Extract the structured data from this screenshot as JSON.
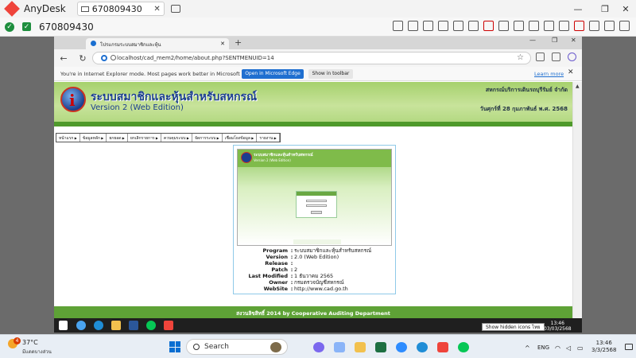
{
  "anydesk": {
    "app_name": "AnyDesk",
    "tab_id": "670809430",
    "session_id": "670809430"
  },
  "browser": {
    "tab_title": "โปรแกรมระบบสมาชิกและหุ้น",
    "url": "localhost/cad_mem2/home/about.php?SENTMENUID=14",
    "ie_mode_message": "You're in Internet Explorer mode. Most pages work better in Microsoft Edge.",
    "open_edge_label": "Open in Microsoft Edge",
    "show_toolbar_label": "Show in toolbar",
    "learn_more_label": "Learn more"
  },
  "site": {
    "title": "ระบบสมาชิกและหุ้นสำหรับสหกรณ์",
    "version": "Version 2 (Web Edition)",
    "organization": "สหกรณ์บริการเดินรถบุรีรัมย์ จำกัด",
    "date": "วันศุกร์ที่ 28 กุมภาพันธ์ พ.ศ. 2568",
    "menu": [
      "หน้าแรก",
      "ข้อมูลหลัก",
      "ยกยอด",
      "ยกเลิกรายการ",
      "ควบคุมระบบ",
      "จัดการระบบ",
      "เชื่อมโยงข้อมูล",
      "รายงาน"
    ],
    "about_screenshot": {
      "title": "ระบบสมาชิกและหุ้นสำหรับสหกรณ์",
      "version": "Version 2 (Web Edition)"
    },
    "program_info": [
      {
        "label": "Program",
        "value": "ระบบสมาชิกและหุ้นสำหรับสหกรณ์"
      },
      {
        "label": "Version",
        "value": "2.0 (Web Edition)"
      },
      {
        "label": "Release",
        "value": ""
      },
      {
        "label": "Patch",
        "value": "2"
      },
      {
        "label": "Last Modified",
        "value": "1 ธันวาคม 2565"
      },
      {
        "label": "Owner",
        "value": "กรมตรวจบัญชีสหกรณ์"
      },
      {
        "label": "WebSite",
        "value": "http://www.cad.go.th"
      }
    ],
    "footer": "สงวนลิขสิทธิ์ 2014 by Cooperative Auditing Department"
  },
  "remote_taskbar": {
    "tooltip": "Show hidden icons",
    "tooltip_suffix": "ไทย",
    "time": "13:46",
    "date": "03/03/2568"
  },
  "taskbar": {
    "weather_badge": "4",
    "temperature": "37°C",
    "weather_condition": "มีแดดบางส่วน",
    "search_label": "Search",
    "language": "ENG",
    "time": "13:46",
    "date": "3/3/2568"
  },
  "colors": {
    "accent_green": "#5ea236",
    "header_green": "#a6d16d",
    "edge_blue": "#1f6fd0",
    "anydesk_red": "#ef443b"
  }
}
